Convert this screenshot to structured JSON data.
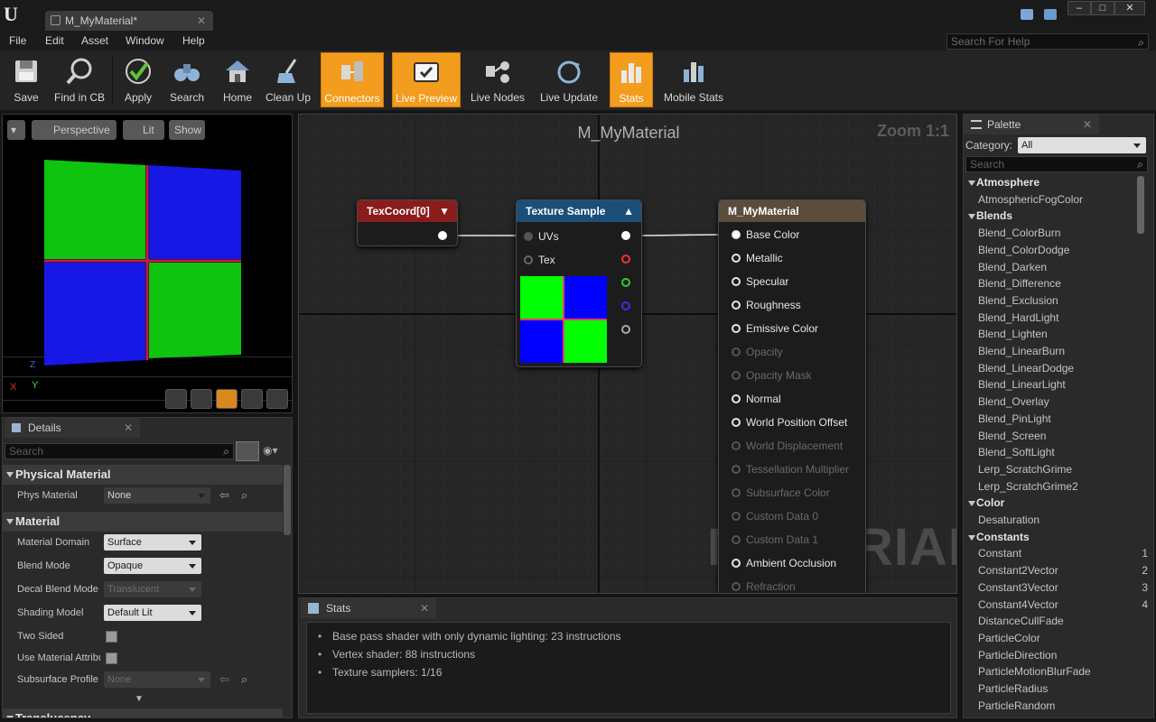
{
  "app": {
    "tab_title": "M_MyMaterial*",
    "tab_close": "✕",
    "logo": "U"
  },
  "menu": {
    "items": [
      "File",
      "Edit",
      "Asset",
      "Window",
      "Help"
    ],
    "help_search_placeholder": "Search For Help"
  },
  "toolbar": {
    "buttons": [
      {
        "label": "Save",
        "icon": "save-icon",
        "active": false
      },
      {
        "label": "Find in CB",
        "icon": "find-icon",
        "active": false
      },
      {
        "label": "Apply",
        "icon": "apply-icon",
        "active": false
      },
      {
        "label": "Search",
        "icon": "search-icon",
        "active": false
      },
      {
        "label": "Home",
        "icon": "home-icon",
        "active": false
      },
      {
        "label": "Clean Up",
        "icon": "cleanup-icon",
        "active": false
      },
      {
        "label": "Connectors",
        "icon": "connectors-icon",
        "active": true
      },
      {
        "label": "Live Preview",
        "icon": "live-preview-icon",
        "active": true
      },
      {
        "label": "Live Nodes",
        "icon": "live-nodes-icon",
        "active": false
      },
      {
        "label": "Live Update",
        "icon": "live-update-icon",
        "active": false
      },
      {
        "label": "Stats",
        "icon": "stats-icon",
        "active": true
      },
      {
        "label": "Mobile Stats",
        "icon": "mobile-stats-icon",
        "active": false
      }
    ]
  },
  "viewport": {
    "perspective": "Perspective",
    "lit": "Lit",
    "show": "Show",
    "axis_x": "X",
    "axis_y": "Y",
    "axis_z": "Z"
  },
  "details": {
    "tab": "Details",
    "search_placeholder": "Search",
    "categories": {
      "physical_material": "Physical Material",
      "material": "Material",
      "translucency": "Translucency"
    },
    "phys_material": {
      "name": "Phys Material",
      "value": "None"
    },
    "material_domain": {
      "name": "Material Domain",
      "value": "Surface"
    },
    "blend_mode": {
      "name": "Blend Mode",
      "value": "Opaque"
    },
    "decal_blend_mode": {
      "name": "Decal Blend Mode",
      "value": "Translucent"
    },
    "shading_model": {
      "name": "Shading Model",
      "value": "Default Lit"
    },
    "two_sided": {
      "name": "Two Sided"
    },
    "use_material_attributes": {
      "name": "Use Material Attributes"
    },
    "subsurface_profile": {
      "name": "Subsurface Profile",
      "value": "None"
    }
  },
  "graph": {
    "title": "M_MyMaterial",
    "zoom": "Zoom 1:1",
    "watermark": "MATERIAL",
    "texcoord_node": {
      "title": "TexCoord[0]",
      "color": "#8a1c1c"
    },
    "texture_sample_node": {
      "title": "Texture Sample",
      "inputs": [
        "UVs",
        "Tex"
      ],
      "color": "#1b4f7a"
    },
    "material_node": {
      "title": "M_MyMaterial",
      "color": "#5c4c3c",
      "pins": [
        {
          "label": "Base Color",
          "enabled": true
        },
        {
          "label": "Metallic",
          "enabled": true
        },
        {
          "label": "Specular",
          "enabled": true
        },
        {
          "label": "Roughness",
          "enabled": true
        },
        {
          "label": "Emissive Color",
          "enabled": true
        },
        {
          "label": "Opacity",
          "enabled": false
        },
        {
          "label": "Opacity Mask",
          "enabled": false
        },
        {
          "label": "Normal",
          "enabled": true
        },
        {
          "label": "World Position Offset",
          "enabled": true
        },
        {
          "label": "World Displacement",
          "enabled": false
        },
        {
          "label": "Tessellation Multiplier",
          "enabled": false
        },
        {
          "label": "Subsurface Color",
          "enabled": false
        },
        {
          "label": "Custom Data 0",
          "enabled": false
        },
        {
          "label": "Custom Data 1",
          "enabled": false
        },
        {
          "label": "Ambient Occlusion",
          "enabled": true
        },
        {
          "label": "Refraction",
          "enabled": false
        }
      ]
    }
  },
  "stats": {
    "tab": "Stats",
    "lines": [
      "Base pass shader with only dynamic lighting: 23 instructions",
      "Vertex shader: 88 instructions",
      "Texture samplers: 1/16"
    ]
  },
  "palette": {
    "tab": "Palette",
    "category_label": "Category:",
    "category_value": "All",
    "search_placeholder": "Search",
    "entries": [
      {
        "type": "cat",
        "label": "Atmosphere"
      },
      {
        "type": "item",
        "label": "AtmosphericFogColor"
      },
      {
        "type": "cat",
        "label": "Blends"
      },
      {
        "type": "item",
        "label": "Blend_ColorBurn"
      },
      {
        "type": "item",
        "label": "Blend_ColorDodge"
      },
      {
        "type": "item",
        "label": "Blend_Darken"
      },
      {
        "type": "item",
        "label": "Blend_Difference"
      },
      {
        "type": "item",
        "label": "Blend_Exclusion"
      },
      {
        "type": "item",
        "label": "Blend_HardLight"
      },
      {
        "type": "item",
        "label": "Blend_Lighten"
      },
      {
        "type": "item",
        "label": "Blend_LinearBurn"
      },
      {
        "type": "item",
        "label": "Blend_LinearDodge"
      },
      {
        "type": "item",
        "label": "Blend_LinearLight"
      },
      {
        "type": "item",
        "label": "Blend_Overlay"
      },
      {
        "type": "item",
        "label": "Blend_PinLight"
      },
      {
        "type": "item",
        "label": "Blend_Screen"
      },
      {
        "type": "item",
        "label": "Blend_SoftLight"
      },
      {
        "type": "item",
        "label": "Lerp_ScratchGrime"
      },
      {
        "type": "item",
        "label": "Lerp_ScratchGrime2"
      },
      {
        "type": "cat",
        "label": "Color"
      },
      {
        "type": "item",
        "label": "Desaturation"
      },
      {
        "type": "cat",
        "label": "Constants"
      },
      {
        "type": "item",
        "label": "Constant",
        "hotkey": "1"
      },
      {
        "type": "item",
        "label": "Constant2Vector",
        "hotkey": "2"
      },
      {
        "type": "item",
        "label": "Constant3Vector",
        "hotkey": "3"
      },
      {
        "type": "item",
        "label": "Constant4Vector",
        "hotkey": "4"
      },
      {
        "type": "item",
        "label": "DistanceCullFade"
      },
      {
        "type": "item",
        "label": "ParticleColor"
      },
      {
        "type": "item",
        "label": "ParticleDirection"
      },
      {
        "type": "item",
        "label": "ParticleMotionBlurFade"
      },
      {
        "type": "item",
        "label": "ParticleRadius"
      },
      {
        "type": "item",
        "label": "ParticleRandom"
      }
    ]
  },
  "colors": {
    "accent": "#f39c1d",
    "texcoord_header": "#8a1c1c",
    "texture_header": "#1b4f7a",
    "material_header": "#5c4c3c",
    "green": "#00ff00",
    "blue": "#0000ff"
  }
}
